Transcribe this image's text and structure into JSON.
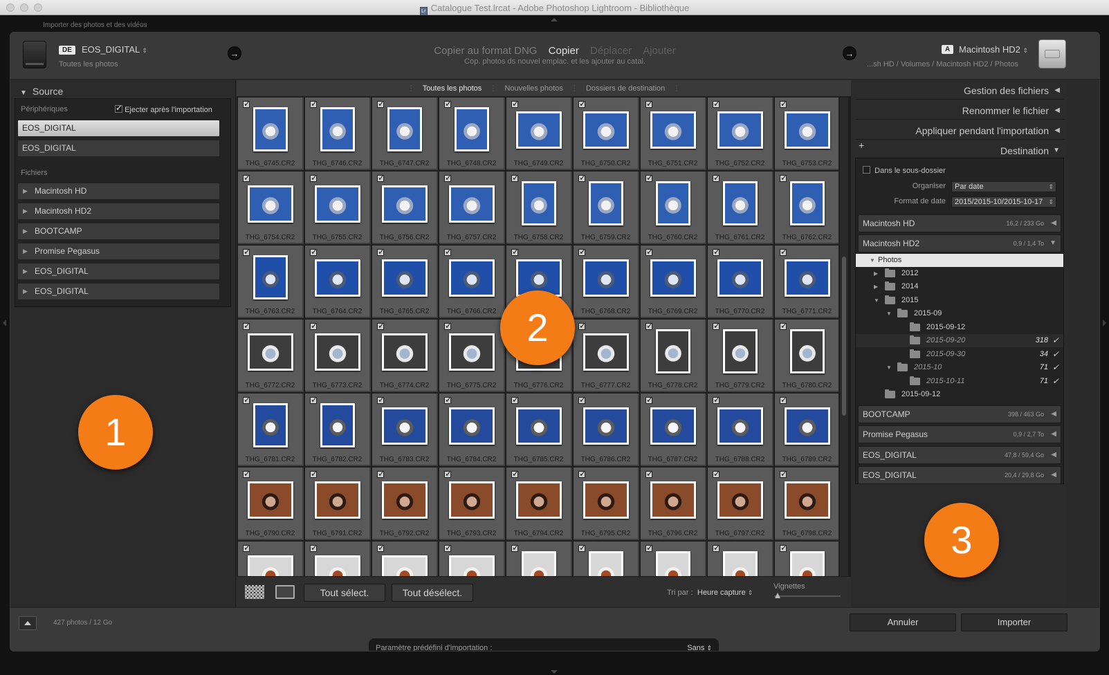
{
  "window": {
    "title": "Catalogue Test.lrcat - Adobe Photoshop Lightroom - Bibliothèque",
    "top_label": "Importer des photos et des vidéos"
  },
  "header": {
    "source_badge": "DE",
    "source_name": "EOS_DIGITAL",
    "source_sub": "Toutes les photos",
    "modes": [
      "Copier au format DNG",
      "Copier",
      "Déplacer",
      "Ajouter"
    ],
    "active_mode": "Copier",
    "mode_description": "Cop. photos ds nouvel emplac. et les ajouter au catal.",
    "dest_badge": "A",
    "dest_name": "Macintosh HD2",
    "dest_path": "...sh HD / Volumes / Macintosh HD2 / Photos"
  },
  "left_panel": {
    "title": "Source",
    "devices_label": "Périphériques",
    "eject_label": "Ejecter après l'importation",
    "devices": [
      "EOS_DIGITAL",
      "EOS_DIGITAL"
    ],
    "files_label": "Fichiers",
    "files": [
      "Macintosh HD",
      "Macintosh HD2",
      "BOOTCAMP",
      "Promise Pegasus",
      "EOS_DIGITAL",
      "EOS_DIGITAL"
    ]
  },
  "view_tabs": [
    "Toutes les photos",
    "Nouvelles photos",
    "Dossiers de destination"
  ],
  "photos": [
    "THG_6745.CR2",
    "THG_6746.CR2",
    "THG_6747.CR2",
    "THG_6748.CR2",
    "THG_6749.CR2",
    "THG_6750.CR2",
    "THG_6751.CR2",
    "THG_6752.CR2",
    "THG_6753.CR2",
    "THG_6754.CR2",
    "THG_6755.CR2",
    "THG_6756.CR2",
    "THG_6757.CR2",
    "THG_6758.CR2",
    "THG_6759.CR2",
    "THG_6760.CR2",
    "THG_6761.CR2",
    "THG_6762.CR2",
    "THG_6763.CR2",
    "THG_6764.CR2",
    "THG_6765.CR2",
    "THG_6766.CR2",
    "THG_6767.CR2",
    "THG_6768.CR2",
    "THG_6769.CR2",
    "THG_6770.CR2",
    "THG_6771.CR2",
    "THG_6772.CR2",
    "THG_6773.CR2",
    "THG_6774.CR2",
    "THG_6775.CR2",
    "THG_6776.CR2",
    "THG_6777.CR2",
    "THG_6778.CR2",
    "THG_6779.CR2",
    "THG_6780.CR2",
    "THG_6781.CR2",
    "THG_6782.CR2",
    "THG_6783.CR2",
    "THG_6784.CR2",
    "THG_6785.CR2",
    "THG_6786.CR2",
    "THG_6787.CR2",
    "THG_6788.CR2",
    "THG_6789.CR2",
    "THG_6790.CR2",
    "THG_6791.CR2",
    "THG_6792.CR2",
    "THG_6793.CR2",
    "THG_6794.CR2",
    "THG_6795.CR2",
    "THG_6796.CR2",
    "THG_6797.CR2",
    "THG_6798.CR2",
    "",
    "",
    "",
    "",
    "",
    "",
    "",
    "",
    ""
  ],
  "bottom_tools": {
    "select_all": "Tout sélect.",
    "deselect_all": "Tout désélect.",
    "sort_label": "Tri par :",
    "sort_value": "Heure capture",
    "thumbs_label": "Vignettes"
  },
  "right_panel": {
    "sections": [
      "Gestion des fichiers",
      "Renommer le fichier",
      "Appliquer pendant l'importation",
      "Destination"
    ],
    "subfolder_label": "Dans le sous-dossier",
    "organize_label": "Organiser",
    "organize_value": "Par date",
    "date_format_label": "Format de date",
    "date_format_value": "2015/2015-10/2015-10-17",
    "volumes_top": [
      {
        "name": "Macintosh HD",
        "cap": "16,2 / 233 Go"
      },
      {
        "name": "Macintosh HD2",
        "cap": "0,9 / 1,4 To"
      }
    ],
    "tree": [
      {
        "label": "Photos"
      },
      {
        "label": "2012"
      },
      {
        "label": "2014"
      },
      {
        "label": "2015"
      },
      {
        "label": "2015-09"
      },
      {
        "label": "2015-09-12"
      },
      {
        "label": "2015-09-20",
        "count": "318"
      },
      {
        "label": "2015-09-30",
        "count": "34"
      },
      {
        "label": "2015-10",
        "count": "71"
      },
      {
        "label": "2015-10-11",
        "count": "71"
      },
      {
        "label": "2015-09-12"
      }
    ],
    "volumes_bottom": [
      {
        "name": "BOOTCAMP",
        "cap": "398 / 463 Go"
      },
      {
        "name": "Promise Pegasus",
        "cap": "0,9 / 2,7 To"
      },
      {
        "name": "EOS_DIGITAL",
        "cap": "47,8 / 59,4 Go"
      },
      {
        "name": "EOS_DIGITAL",
        "cap": "20,4 / 29,8 Go"
      }
    ]
  },
  "footer": {
    "count": "427 photos / 12 Go",
    "preset_label": "Paramètre prédéfini d'importation :",
    "preset_value": "Sans",
    "cancel": "Annuler",
    "import": "Importer"
  },
  "callouts": [
    "1",
    "2",
    "3"
  ]
}
